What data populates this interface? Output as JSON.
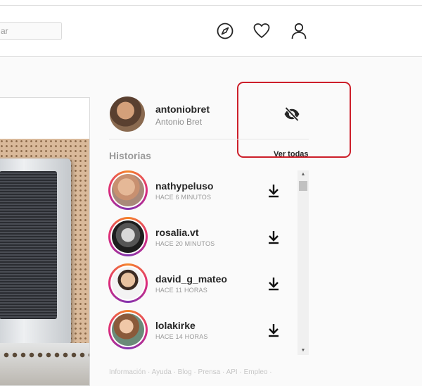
{
  "header": {
    "search_placeholder": "ar",
    "icons": [
      "compass-icon",
      "heart-icon",
      "user-icon"
    ]
  },
  "profile": {
    "username": "antoniobret",
    "full_name": "Antonio Bret",
    "hide_icon": "eye-slash-icon"
  },
  "stories": {
    "title": "Historias",
    "see_all": "Ver todas",
    "items": [
      {
        "username": "nathypeluso",
        "time": "HACE 6 MINUTOS"
      },
      {
        "username": "rosalia.vt",
        "time": "HACE 20 MINUTOS"
      },
      {
        "username": "david_g_mateo",
        "time": "HACE 11 HORAS"
      },
      {
        "username": "lolakirke",
        "time": "HACE 14 HORAS"
      }
    ]
  },
  "footer": {
    "links_text": "Información · Ayuda · Blog · Prensa · API · Empleo ·"
  },
  "colors": {
    "highlight_box": "#cc1f2a",
    "story_ring": "#dd2a7b"
  }
}
